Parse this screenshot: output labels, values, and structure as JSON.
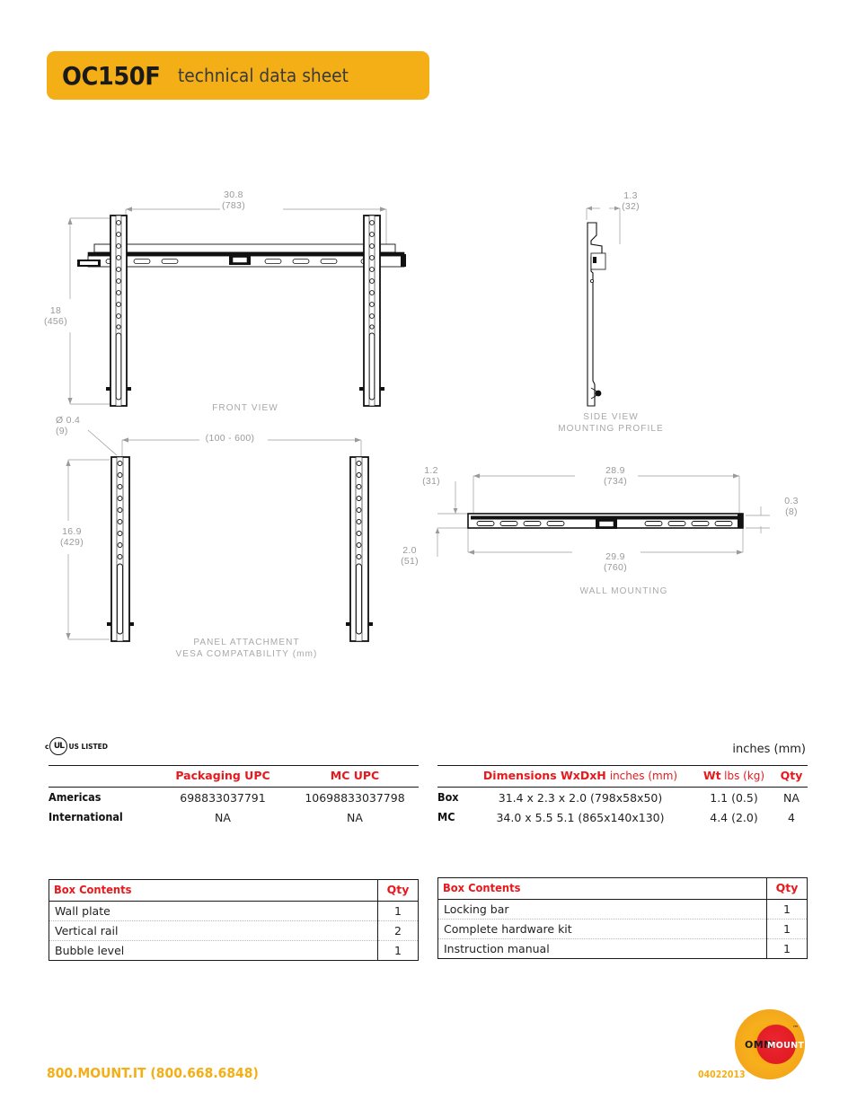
{
  "header": {
    "model": "OC150F",
    "subtitle": "technical data sheet"
  },
  "drawings": {
    "front_view": {
      "label": "FRONT VIEW",
      "width_in": "30.8",
      "width_mm": "(783)",
      "height_in": "18",
      "height_mm": "(456)"
    },
    "side_view": {
      "label_line1": "SIDE VIEW",
      "label_line2": "MOUNTING PROFILE",
      "depth_in": "1.3",
      "depth_mm": "(32)"
    },
    "panel_attachment": {
      "label_line1": "PANEL ATTACHMENT",
      "label_line2": "VESA COMPATABILITY (mm)",
      "hole_dia_in": "Ø 0.4",
      "hole_dia_mm": "(9)",
      "vesa_range": "(100 - 600)",
      "rail_height_in": "16.9",
      "rail_height_mm": "(429)"
    },
    "wall_mounting": {
      "label": "WALL MOUNTING",
      "inner_width_in": "28.9",
      "inner_width_mm": "(734)",
      "outer_width_in": "29.9",
      "outer_width_mm": "(760)",
      "top_offset_in": "1.2",
      "top_offset_mm": "(31)",
      "bottom_offset_in": "2.0",
      "bottom_offset_mm": "(51)",
      "thickness_in": "0.3",
      "thickness_mm": "(8)"
    }
  },
  "certification": {
    "ul_prefix": "c",
    "ul_mark": "UL",
    "ul_suffix": "US LISTED"
  },
  "upc_table": {
    "columns": [
      "",
      "Packaging UPC",
      "MC UPC"
    ],
    "rows": [
      {
        "region": "Americas",
        "packaging_upc": "698833037791",
        "mc_upc": "10698833037798"
      },
      {
        "region": "International",
        "packaging_upc": "NA",
        "mc_upc": "NA"
      }
    ]
  },
  "dimensions_table": {
    "units_note": "inches (mm)",
    "col_dimensions_bold": "Dimensions WxDxH",
    "col_dimensions_light": "inches (mm)",
    "col_weight_bold": "Wt",
    "col_weight_light": "lbs (kg)",
    "col_qty": "Qty",
    "rows": [
      {
        "label": "Box",
        "dimensions": "31.4 x 2.3 x 2.0 (798x58x50)",
        "weight": "1.1 (0.5)",
        "qty": "NA"
      },
      {
        "label": "MC",
        "dimensions": "34.0 x 5.5  5.1 (865x140x130)",
        "weight": "4.4 (2.0)",
        "qty": "4"
      }
    ]
  },
  "box_contents_left": {
    "title": "Box Contents",
    "qty_header": "Qty",
    "rows": [
      {
        "item": "Wall plate",
        "qty": "1"
      },
      {
        "item": "Vertical rail",
        "qty": "2"
      },
      {
        "item": "Bubble level",
        "qty": "1"
      }
    ]
  },
  "box_contents_right": {
    "title": "Box Contents",
    "qty_header": "Qty",
    "rows": [
      {
        "item": "Locking bar",
        "qty": "1"
      },
      {
        "item": "Complete hardware kit",
        "qty": "1"
      },
      {
        "item": "Instruction manual",
        "qty": "1"
      }
    ]
  },
  "footer": {
    "phone": "800.MOUNT.IT (800.668.6848)",
    "date_code": "04022013",
    "logo_omni": "OMNI",
    "logo_mount": "MOUNT",
    "logo_tm": "™"
  },
  "colors": {
    "brand_yellow": "#F4AF17",
    "accent_red": "#E8191C",
    "dim_gray": "#9a9a9a",
    "ink": "#1a1a1a"
  }
}
